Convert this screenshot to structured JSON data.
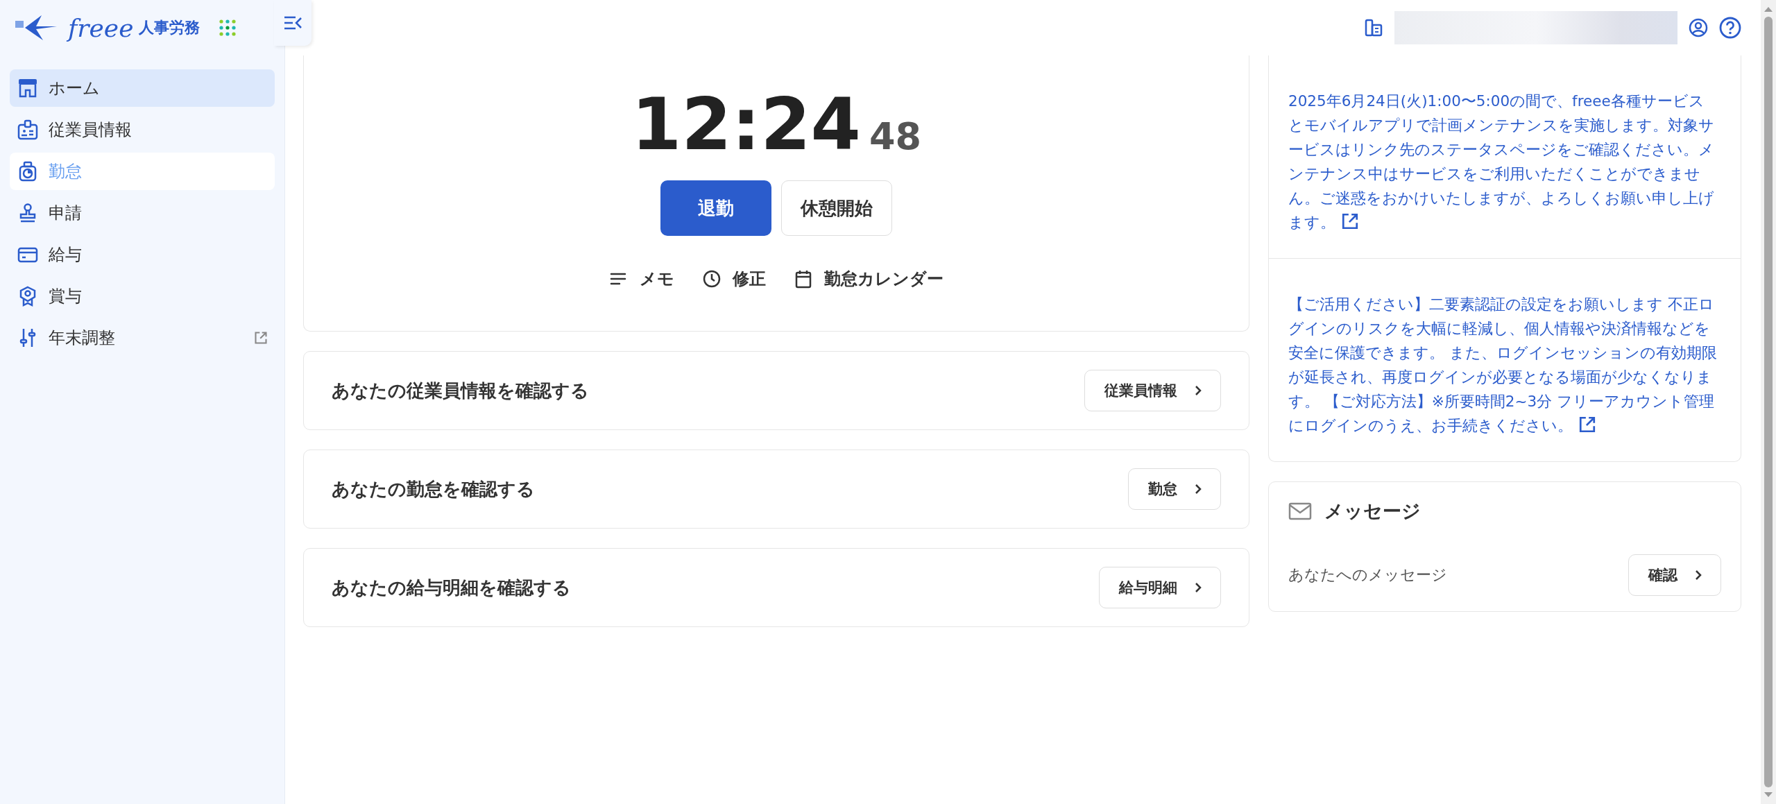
{
  "app": {
    "logo_text": "freee",
    "product": "人事労務"
  },
  "sidebar": {
    "items": [
      {
        "label": "ホーム",
        "kind": "home",
        "selected": true,
        "highlighted": false,
        "external": false
      },
      {
        "label": "従業員情報",
        "kind": "badge",
        "selected": false,
        "highlighted": false,
        "external": false
      },
      {
        "label": "勤怠",
        "kind": "timer",
        "selected": false,
        "highlighted": true,
        "external": false
      },
      {
        "label": "申請",
        "kind": "stamp",
        "selected": false,
        "highlighted": false,
        "external": false
      },
      {
        "label": "給与",
        "kind": "card",
        "selected": false,
        "highlighted": false,
        "external": false
      },
      {
        "label": "賞与",
        "kind": "award",
        "selected": false,
        "highlighted": false,
        "external": false
      },
      {
        "label": "年末調整",
        "kind": "sliders",
        "selected": false,
        "highlighted": false,
        "external": true
      }
    ]
  },
  "clock": {
    "time": "12:24",
    "seconds": "48",
    "buttons": [
      {
        "label": "退勤",
        "kind": "primary"
      },
      {
        "label": "休憩開始",
        "kind": "secondary"
      }
    ],
    "actions": [
      {
        "label": "メモ",
        "kind": "memo"
      },
      {
        "label": "修正",
        "kind": "clock"
      },
      {
        "label": "勤怠カレンダー",
        "kind": "calendar"
      }
    ]
  },
  "shortcuts": [
    {
      "title": "あなたの従業員情報を確認する",
      "button": "従業員情報"
    },
    {
      "title": "あなたの勤怠を確認する",
      "button": "勤怠"
    },
    {
      "title": "あなたの給与明細を確認する",
      "button": "給与明細"
    }
  ],
  "notices": [
    {
      "text": "2025年6月24日(火)1:00〜5:00の間で、freee各種サービスとモバイルアプリで計画メンテナンスを実施します。対象サービスはリンク先のステータスページをご確認ください。メンテナンス中はサービスをご利用いただくことができません。ご迷惑をおかけいたしますが、よろしくお願い申し上げます。"
    },
    {
      "text": "【ご活用ください】二要素認証の設定をお願いします 不正ログインのリスクを大幅に軽減し、個人情報や決済情報などを安全に保護できます。 また、ログインセッションの有効期限が延長され、再度ログインが必要となる場面が少なくなります。 【ご対応方法】※所要時間2~3分 フリーアカウント管理にログインのうえ、お手続きください。"
    }
  ],
  "messages": {
    "title": "メッセージ",
    "text": "あなたへのメッセージ",
    "button": "確認"
  }
}
